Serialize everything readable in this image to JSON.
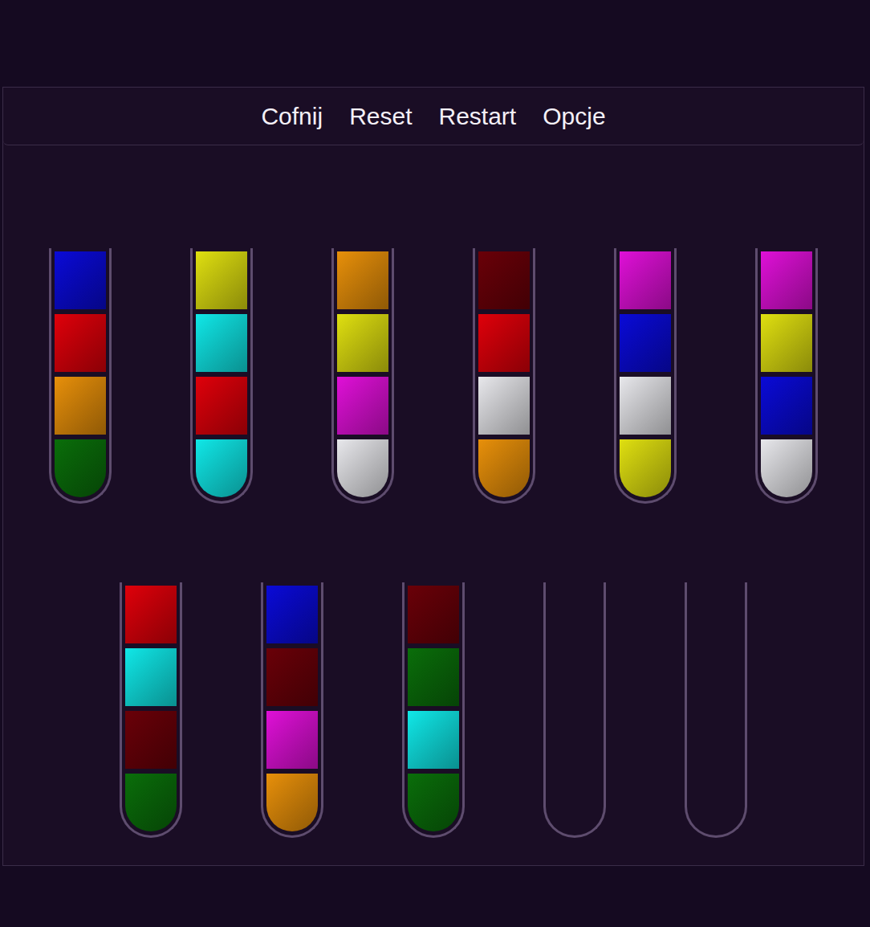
{
  "menu": [
    {
      "label": "Cofnij"
    },
    {
      "label": "Reset"
    },
    {
      "label": "Restart"
    },
    {
      "label": "Opcje"
    }
  ],
  "rows": [
    {
      "tubes": [
        {
          "balls": [
            {
              "color": "#0a0ad8"
            },
            {
              "color": "#e0000a"
            },
            {
              "color": "#e8900a"
            },
            {
              "color": "#0a6e0a"
            }
          ]
        },
        {
          "balls": [
            {
              "color": "#e0e010"
            },
            {
              "color": "#10e8e8"
            },
            {
              "color": "#e0000a"
            },
            {
              "color": "#10e8e8"
            }
          ]
        },
        {
          "balls": [
            {
              "color": "#e8900a"
            },
            {
              "color": "#e0e010"
            },
            {
              "color": "#e010d8"
            },
            {
              "color": "#e8e8ec"
            }
          ]
        },
        {
          "balls": [
            {
              "color": "#6a0008"
            },
            {
              "color": "#e0000a"
            },
            {
              "color": "#e8e8ec"
            },
            {
              "color": "#e8900a"
            }
          ]
        },
        {
          "balls": [
            {
              "color": "#e010d8"
            },
            {
              "color": "#0a0ad8"
            },
            {
              "color": "#e8e8ec"
            },
            {
              "color": "#e0e010"
            }
          ]
        },
        {
          "balls": [
            {
              "color": "#e010d8"
            },
            {
              "color": "#e0e010"
            },
            {
              "color": "#0a0ad8"
            },
            {
              "color": "#e8e8ec"
            }
          ]
        }
      ]
    },
    {
      "tubes": [
        {
          "balls": [
            {
              "color": "#e0000a"
            },
            {
              "color": "#10e8e8"
            },
            {
              "color": "#6a0008"
            },
            {
              "color": "#0a6e0a"
            }
          ]
        },
        {
          "balls": [
            {
              "color": "#0a0ad8"
            },
            {
              "color": "#6a0008"
            },
            {
              "color": "#e010d8"
            },
            {
              "color": "#e8900a"
            }
          ]
        },
        {
          "balls": [
            {
              "color": "#6a0008"
            },
            {
              "color": "#0a6e0a"
            },
            {
              "color": "#10e8e8"
            },
            {
              "color": "#0a6e0a"
            }
          ]
        },
        {
          "balls": []
        },
        {
          "balls": []
        }
      ]
    }
  ]
}
